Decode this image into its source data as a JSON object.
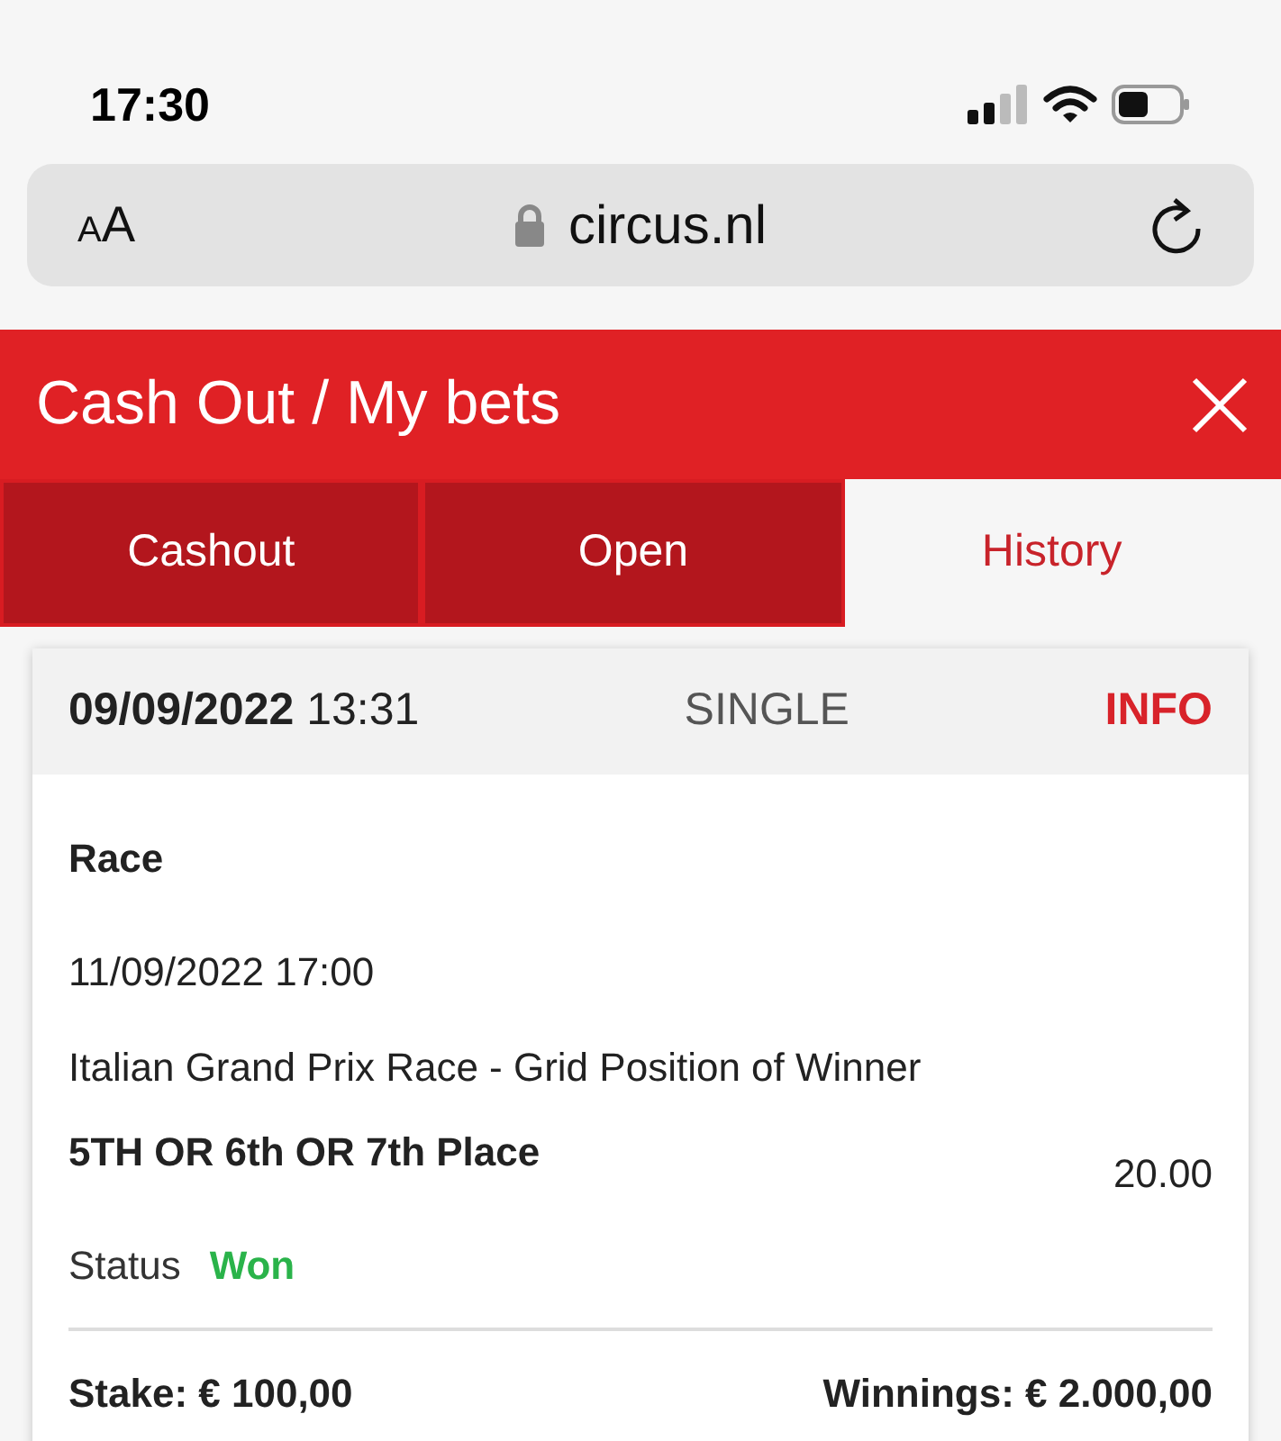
{
  "status_bar": {
    "time": "17:30"
  },
  "browser": {
    "text_size": "AA",
    "url": "circus.nl"
  },
  "header": {
    "title": "Cash Out / My bets"
  },
  "tabs": [
    {
      "label": "Cashout",
      "selected": false
    },
    {
      "label": "Open",
      "selected": false
    },
    {
      "label": "History",
      "selected": true
    }
  ],
  "bet": {
    "date": "09/09/2022",
    "time": "13:31",
    "type": "SINGLE",
    "info": "INFO",
    "event_type": "Race",
    "event_time": "11/09/2022 17:00",
    "market": "Italian Grand Prix Race - Grid Position of Winner",
    "selection": "5TH OR 6th OR 7th Place",
    "odds": "20.00",
    "status_label": "Status",
    "status": "Won",
    "won": true,
    "stake": "Stake: € 100,00",
    "winnings": "Winnings: € 2.000,00"
  }
}
